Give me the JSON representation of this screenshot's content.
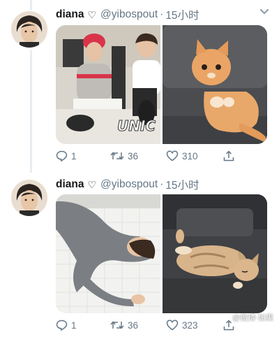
{
  "tweets": [
    {
      "name": "diana",
      "name_emoji": "♡",
      "handle": "@yibospout",
      "separator": "·",
      "time": "15小时",
      "media_left_caption": "UNIC",
      "replies": "1",
      "retweets": "36",
      "likes": "310"
    },
    {
      "name": "diana",
      "name_emoji": "♡",
      "handle": "@yibospout",
      "separator": "·",
      "time": "15小时",
      "replies": "1",
      "retweets": "36",
      "likes": "323"
    }
  ],
  "watermark": "@微博·如果"
}
